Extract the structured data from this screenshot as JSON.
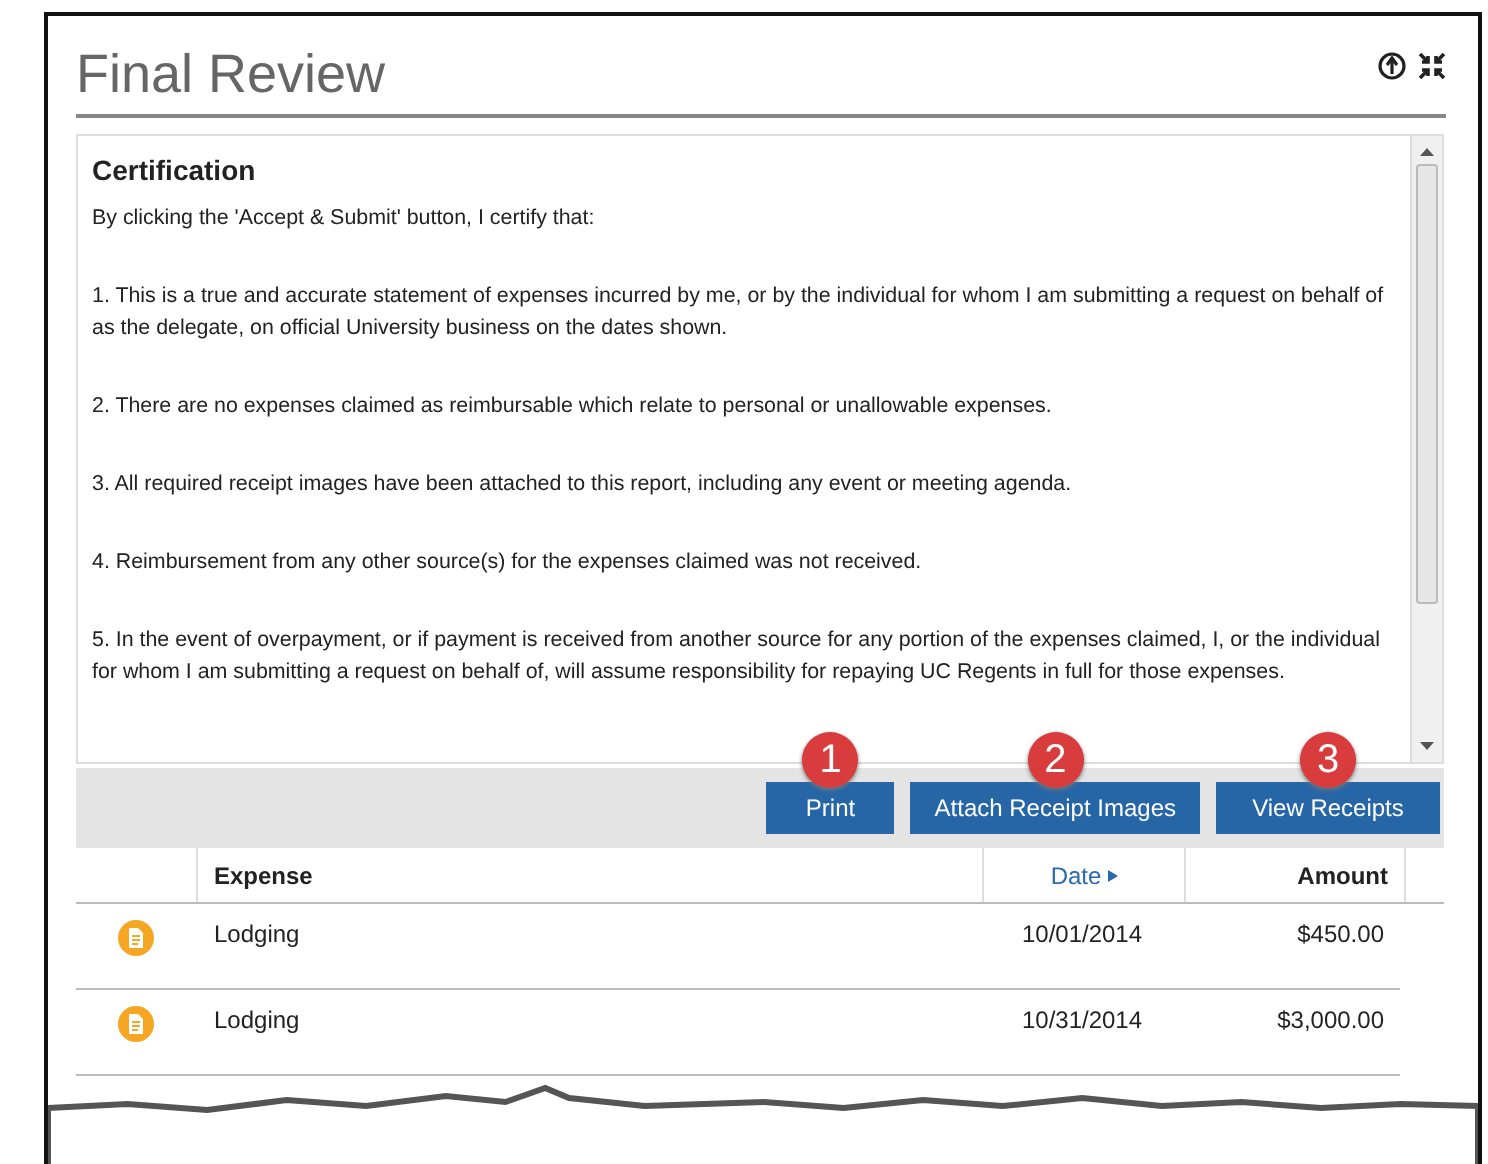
{
  "window": {
    "title": "Final Review"
  },
  "certification": {
    "heading": "Certification",
    "intro": "By clicking the 'Accept & Submit' button, I certify that:",
    "paragraphs": [
      "1. This is a true and accurate statement of expenses incurred by me, or by the individual for whom I am submitting a request on behalf of as the delegate, on official University business on the dates shown.",
      "2. There are no expenses claimed as reimbursable which relate to personal or unallowable expenses.",
      "3. All required receipt images have been attached to this report, including any event or meeting agenda.",
      "4. Reimbursement from any other source(s) for the expenses claimed was not received.",
      "5. In the event of overpayment, or if payment is received from another source for any portion of the expenses claimed, I, or the individual for whom I am submitting a request on behalf of, will assume responsibility for repaying UC Regents in full for those expenses."
    ]
  },
  "buttons": [
    {
      "label": "Print",
      "badge": "1"
    },
    {
      "label": "Attach Receipt Images",
      "badge": "2"
    },
    {
      "label": "View Receipts",
      "badge": "3"
    }
  ],
  "table": {
    "columns": [
      {
        "label": "Expense",
        "sorted": false
      },
      {
        "label": "Date",
        "sorted": true
      },
      {
        "label": "Amount",
        "sorted": false
      }
    ],
    "rows": [
      [
        "Lodging",
        "10/01/2014",
        "$450.00"
      ],
      [
        "Lodging",
        "10/31/2014",
        "$3,000.00"
      ]
    ]
  }
}
